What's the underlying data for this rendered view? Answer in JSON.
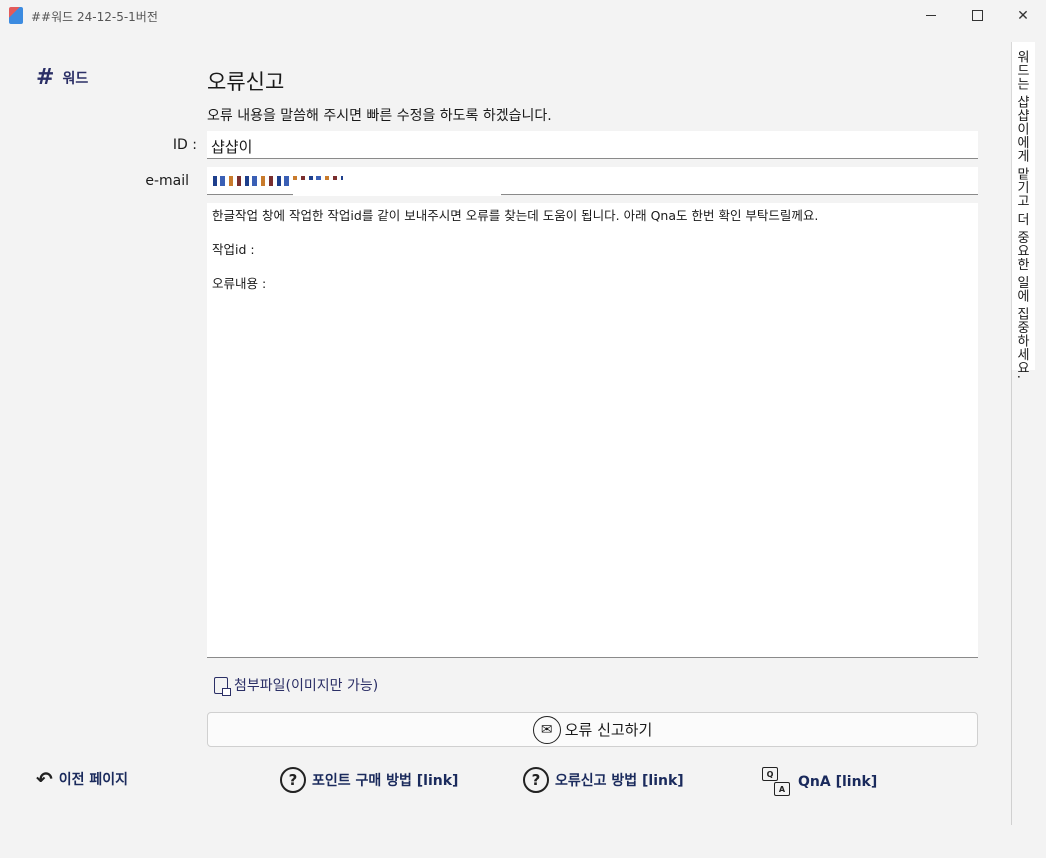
{
  "window": {
    "title": "##워드 24-12-5-1버전"
  },
  "sidebar": {
    "logo_label": "워드"
  },
  "main": {
    "title": "오류신고",
    "subtitle": "오류 내용을 말씀해 주시면 빠른 수정을 하도록 하겠습니다.",
    "id_label": "ID :",
    "id_value": "샵샵이",
    "email_label": "e-mail",
    "message_lines": [
      "한글작업 창에 작업한 작업id를 같이 보내주시면 오류를 찾는데 도움이 됩니다. 아래 Qna도 한번 확인 부탁드릴께요.",
      "작업id :",
      "오류내용 :"
    ],
    "attach_label": "첨부파일(이미지만 가능)",
    "submit_label": "오류 신고하기"
  },
  "footer": {
    "back_label": "이전 페이지",
    "point_label": "포인트 구매 방법 [link]",
    "error_guide_label": "오류신고 방법 [link]",
    "qna_label": "QnA [link]"
  },
  "side_panel": {
    "text": "워드는 샵샵이에게 맡기고 더 중요한 일에 집중하세요."
  },
  "colors": {
    "accent": "#2b2f66",
    "background": "#f3f3f3"
  }
}
